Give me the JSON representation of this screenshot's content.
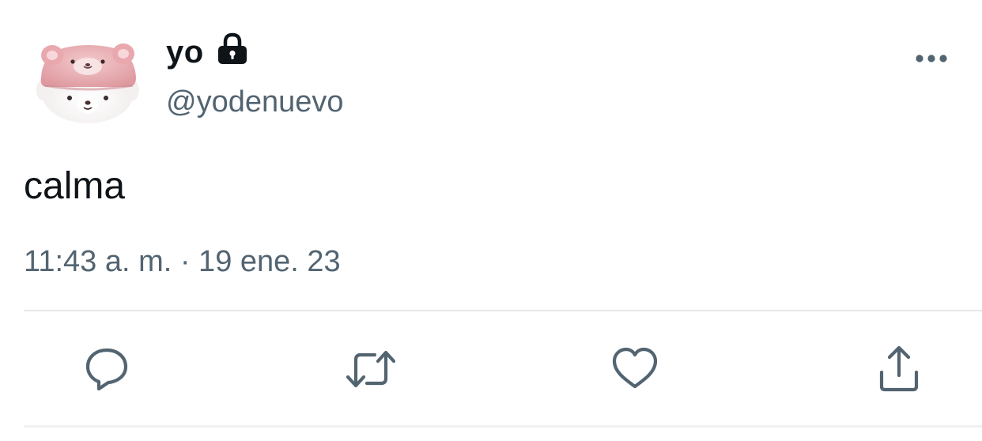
{
  "author": {
    "display_name": "yo",
    "handle": "@yodenuevo",
    "locked": true,
    "avatar": "pink-bear-hat-plush-avatar"
  },
  "tweet": {
    "text": "calma",
    "timestamp": "11:43 a. m. · 19 ene. 23"
  },
  "icons": {
    "lock": "lock-icon",
    "more": "more-dots-icon",
    "reply": "reply-bubble-icon",
    "retweet": "retweet-icon",
    "like": "heart-icon",
    "share": "share-upload-icon"
  },
  "colors": {
    "text_primary": "#0f1419",
    "text_secondary": "#536471",
    "icon_gray": "#536471",
    "divider": "#e7e9ec"
  }
}
